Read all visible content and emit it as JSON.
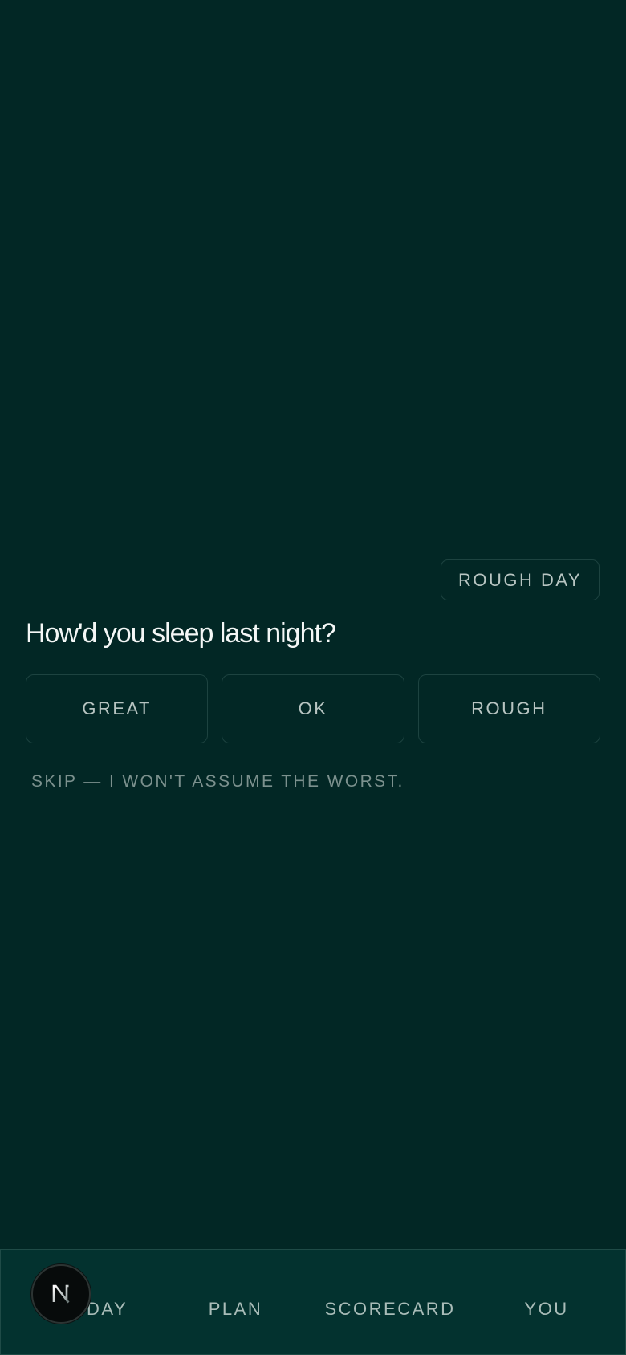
{
  "header": {
    "rough_day_label": "ROUGH DAY"
  },
  "sleep_prompt": {
    "question": "How'd you sleep last night?",
    "options": [
      "GREAT",
      "OK",
      "ROUGH"
    ],
    "skip_label": "SKIP — I WON'T ASSUME THE WORST."
  },
  "bottom_nav": {
    "items": [
      {
        "label": "TODAY"
      },
      {
        "label": "PLAN"
      },
      {
        "label": "SCORECARD"
      },
      {
        "label": "YOU"
      }
    ]
  },
  "badge": {
    "icon": "n-logo-icon",
    "letter": "N"
  },
  "colors": {
    "background": "#022725",
    "nav_background": "#03322f",
    "border": "#1d4340",
    "text_primary": "#f4f7f6",
    "text_muted": "#7c918e"
  }
}
